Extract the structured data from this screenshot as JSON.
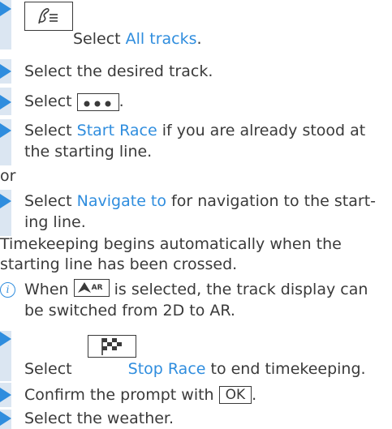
{
  "colors": {
    "accent": "#2f8dde",
    "bar": "#dbe6f2",
    "text": "#3a3a3a"
  },
  "steps": {
    "s1_prefix": "Select ",
    "s1_link": "All tracks",
    "s1_suffix": ".",
    "s2": "Select the desired track.",
    "s3_prefix": "Select ",
    "s3_suffix": ".",
    "s4_prefix": "Select ",
    "s4_link": "Start Race",
    "s4_line1_suffix": " if you are already stood at",
    "s4_line2": "the starting line.",
    "or": "or",
    "s5_prefix": "Select ",
    "s5_link": "Navigate to",
    "s5_line1_suffix": " for navigation to the start-",
    "s5_line2": "ing line.",
    "timekeeping_line1": "Timekeeping begins automatically when the",
    "timekeeping_line2": "starting line has been crossed.",
    "info_icon_glyph": "i",
    "info_prefix": "When ",
    "info_line1_suffix": " is selected, the track display can",
    "info_line2": "be switched from 2D to AR.",
    "ar_badge": "AR",
    "s6_prefix": "Select ",
    "s6_link": "Stop Race",
    "s6_suffix": " to end timekeeping.",
    "s7_prefix": "Confirm the prompt with ",
    "s7_ok": "OK",
    "s7_suffix": ".",
    "s8": "Select the weather."
  },
  "icons": {
    "tracks_icon": "track-list-icon",
    "more_icon": "more-dots-icon",
    "ar_icon": "ar-navigation-icon",
    "stop_icon": "checkered-flag-icon"
  }
}
